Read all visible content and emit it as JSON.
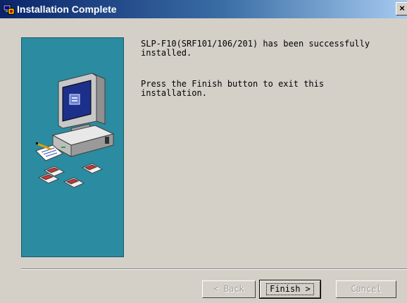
{
  "window": {
    "title": "Installation Complete",
    "close_glyph": "×"
  },
  "message": {
    "line1": "SLP-F10(SRF101/106/201) has been successfully\ninstalled.",
    "line2": "Press the Finish button to exit this\ninstallation."
  },
  "buttons": {
    "back": "< Back",
    "finish": "Finish >",
    "cancel": "Cancel"
  },
  "colors": {
    "title_bar_start": "#0a246a",
    "side_panel": "#2b8ba0",
    "face": "#d4d0c8"
  },
  "icons": {
    "title": "setup-icon",
    "side": "computer-with-disks-illustration"
  }
}
